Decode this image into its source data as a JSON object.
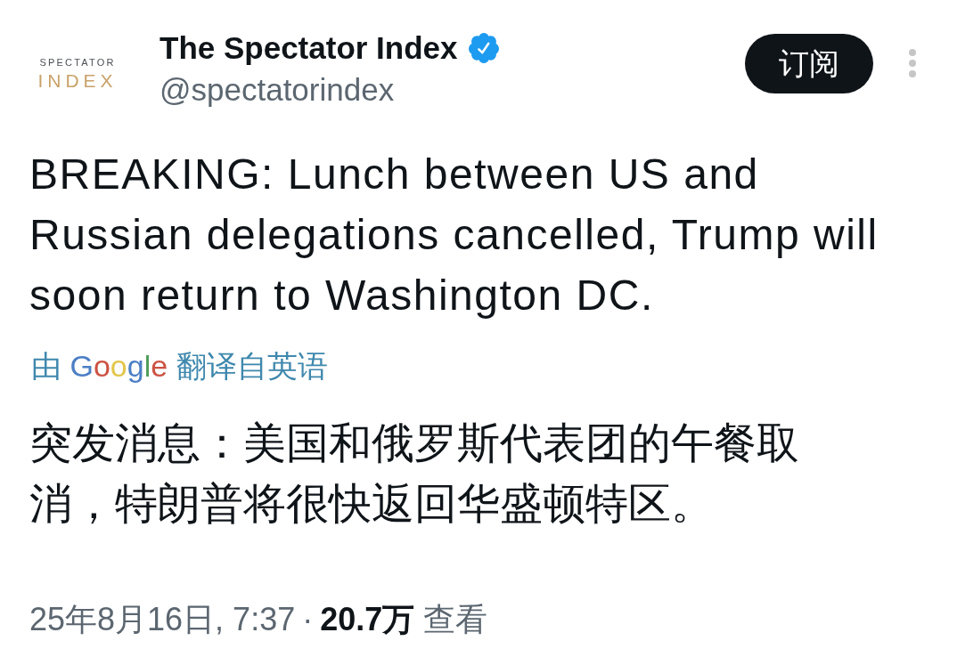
{
  "account": {
    "logo": {
      "line_1": "SPECTATOR",
      "line_2": "INDEX"
    },
    "name": "The Spectator Index",
    "verified": true,
    "handle": "@spectatorindex"
  },
  "subscribe_button": {
    "label": "订阅"
  },
  "post": {
    "text": "BREAKING: Lunch between US and Russian delegations cancelled, Trump will soon return to Washington DC.",
    "translation_note": {
      "prefix": "由",
      "provider": "Google",
      "suffix": "翻译自英语"
    },
    "translated_text": "突发消息：美国和俄罗斯代表团的午餐取消，特朗普将很快返回华盛顿特区。",
    "meta": {
      "timestamp": "25年8月16日, 7:37",
      "separator": "·",
      "views_count": "20.7万",
      "views_label": "查看"
    }
  }
}
